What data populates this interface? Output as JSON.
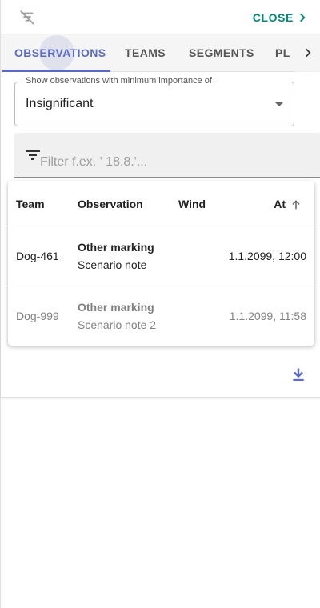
{
  "header": {
    "close_label": "CLOSE",
    "icons": {
      "filter_off": "filter-off-icon",
      "close_chevron": "chevron-right-icon"
    }
  },
  "tabs": [
    {
      "label": "OBSERVATIONS",
      "active": true
    },
    {
      "label": "TEAMS",
      "active": false
    },
    {
      "label": "SEGMENTS",
      "active": false
    },
    {
      "label": "PL",
      "active": false
    }
  ],
  "importance_select": {
    "label": "Show observations with minimum importance of",
    "value": "Insignificant"
  },
  "filter": {
    "placeholder": "Filter f.ex. ' 18.8.'...",
    "value": ""
  },
  "table": {
    "columns": [
      "Team",
      "Observation",
      "Wind",
      "At"
    ],
    "sort": {
      "column": "At",
      "direction": "ascending"
    },
    "rows": [
      {
        "team": "Dog-461",
        "observation": "Other marking",
        "note": "Scenario note",
        "wind": "",
        "at": "1.1.2099, 12:00"
      },
      {
        "team": "Dog-999",
        "observation": "Other marking",
        "note": "Scenario note 2",
        "wind": "",
        "at": "1.1.2099, 11:58"
      }
    ]
  },
  "colors": {
    "accent": "#5c6bc0",
    "close": "#00897b",
    "tab_bar": "#f5f5f5",
    "muted_row_text": "#808080"
  }
}
